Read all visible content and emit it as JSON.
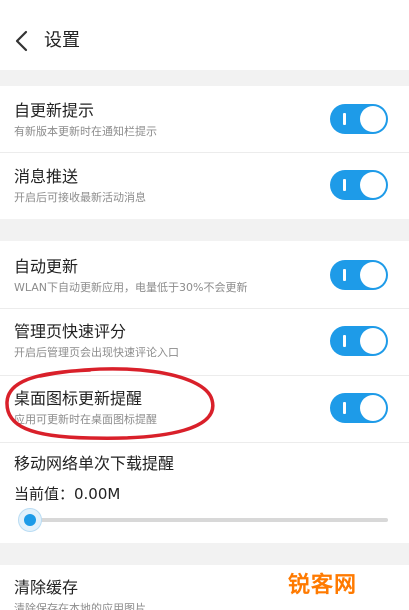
{
  "header": {
    "title": "设置",
    "back_icon": "chevron-left-icon"
  },
  "settings": {
    "update_prompt": {
      "title": "自更新提示",
      "subtitle": "有新版本更新时在通知栏提示",
      "enabled": true
    },
    "push": {
      "title": "消息推送",
      "subtitle": "开启后可接收最新活动消息",
      "enabled": true
    },
    "auto_update": {
      "title": "自动更新",
      "subtitle": "WLAN下自动更新应用，电量低于30%不会更新",
      "enabled": true
    },
    "quick_rate": {
      "title": "管理页快速评分",
      "subtitle": "开启后管理页会出现快速评论入口",
      "enabled": true
    },
    "desktop_badge": {
      "title": "桌面图标更新提醒",
      "subtitle": "应用可更新时在桌面图标提醒",
      "enabled": true
    },
    "mobile_download": {
      "title": "移动网络单次下载提醒",
      "current_value": "当前值：0.00M",
      "slider_level": 0
    },
    "clear_cache": {
      "title": "清除缓存",
      "subtitle": "清除保存在本地的应用图片"
    }
  },
  "colors": {
    "accent": "#1e9be8",
    "annotation": "#d9202a",
    "gap": "#f2f2f2",
    "watermark": "#ff7a00"
  },
  "watermark": {
    "text": "锐客网"
  }
}
